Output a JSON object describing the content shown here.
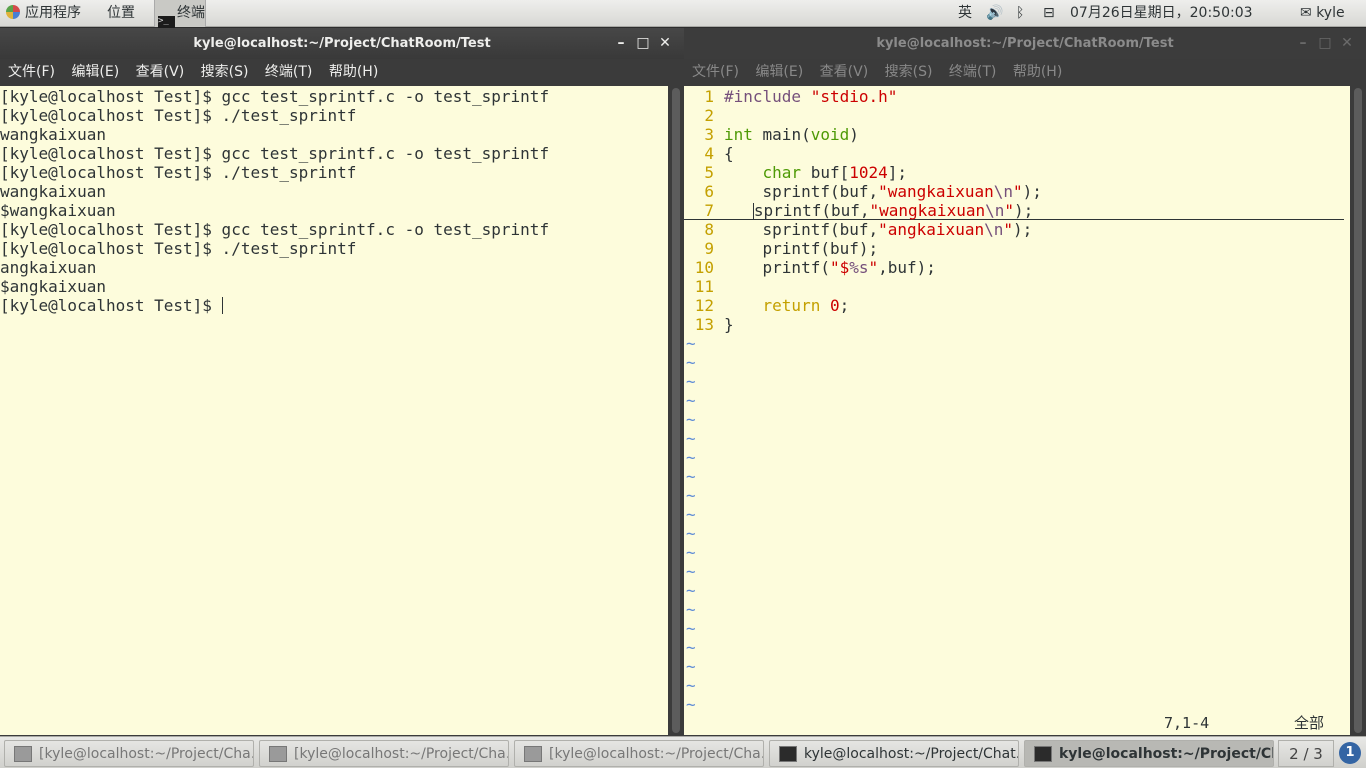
{
  "top_panel": {
    "applications": "应用程序",
    "places": "位置",
    "terminal_app": "终端",
    "input_method": "英",
    "volume_icon": "🔊",
    "bluetooth_icon": "ᛒ",
    "network_icon": "⊟",
    "clock": "07月26日星期日，20:50:03",
    "user": "kyle",
    "user_icon": "✉"
  },
  "left_window": {
    "title": "kyle@localhost:~/Project/ChatRoom/Test",
    "controls": [
      "–",
      "□",
      "✕"
    ],
    "menu": [
      "文件(F)",
      "编辑(E)",
      "查看(V)",
      "搜索(S)",
      "终端(T)",
      "帮助(H)"
    ],
    "lines": [
      "[kyle@localhost Test]$ gcc test_sprintf.c -o test_sprintf",
      "[kyle@localhost Test]$ ./test_sprintf",
      "wangkaixuan",
      "[kyle@localhost Test]$ gcc test_sprintf.c -o test_sprintf",
      "[kyle@localhost Test]$ ./test_sprintf",
      "wangkaixuan",
      "$wangkaixuan",
      "[kyle@localhost Test]$ gcc test_sprintf.c -o test_sprintf",
      "[kyle@localhost Test]$ ./test_sprintf",
      "angkaixuan",
      "$angkaixuan",
      "[kyle@localhost Test]$ "
    ]
  },
  "right_window": {
    "title": "kyle@localhost:~/Project/ChatRoom/Test",
    "controls": [
      "–",
      "□",
      "✕"
    ],
    "menu": [
      "文件(F)",
      "编辑(E)",
      "查看(V)",
      "搜索(S)",
      "终端(T)",
      "帮助(H)"
    ],
    "line_numbers": [
      "1",
      "2",
      "3",
      "4",
      "5",
      "6",
      "7",
      "8",
      "9",
      "10",
      "11",
      "12",
      "13"
    ],
    "code": {
      "l1_pre": "#include",
      "l1_inc": "\"stdio.h\"",
      "l3_type": "int",
      "l3_rest1": " main(",
      "l3_void": "void",
      "l3_rest2": ")",
      "l4": "{",
      "l5_indent": "    ",
      "l5_type": "char",
      "l5_rest1": " buf[",
      "l5_num": "1024",
      "l5_rest2": "];",
      "l6_fn": "    sprintf(buf,",
      "l6_str": "\"wangkaixuan",
      "l6_esc": "\\n",
      "l6_strend": "\"",
      "l6_end": ");",
      "l7_fn": "sprintf(buf,",
      "l7_str": "\"wangkaixuan",
      "l7_esc": "\\n",
      "l7_strend": "\"",
      "l7_end": ");",
      "l8_fn": "    sprintf(buf,",
      "l8_str": "\"angkaixuan",
      "l8_esc": "\\n",
      "l8_strend": "\"",
      "l8_end": ");",
      "l9": "    printf(buf);",
      "l10_fn": "    printf(",
      "l10_str": "\"$",
      "l10_fmt": "%s",
      "l10_strend": "\"",
      "l10_end": ",buf);",
      "l12_indent": "    ",
      "l12_kw": "return",
      "l12_num": " 0",
      "l12_end": ";",
      "l13": "}"
    },
    "tilde": "~",
    "tilde_count": 20,
    "status_position": "7,1-4",
    "status_scroll": "全部"
  },
  "bottom_panel": {
    "tasks": [
      "[kyle@localhost:~/Project/Cha…",
      "[kyle@localhost:~/Project/Cha…",
      "[kyle@localhost:~/Project/Cha…",
      "kyle@localhost:~/Project/Chat…",
      "kyle@localhost:~/Project/Chat…"
    ],
    "workspace": "2 / 3",
    "notifications": "1"
  }
}
